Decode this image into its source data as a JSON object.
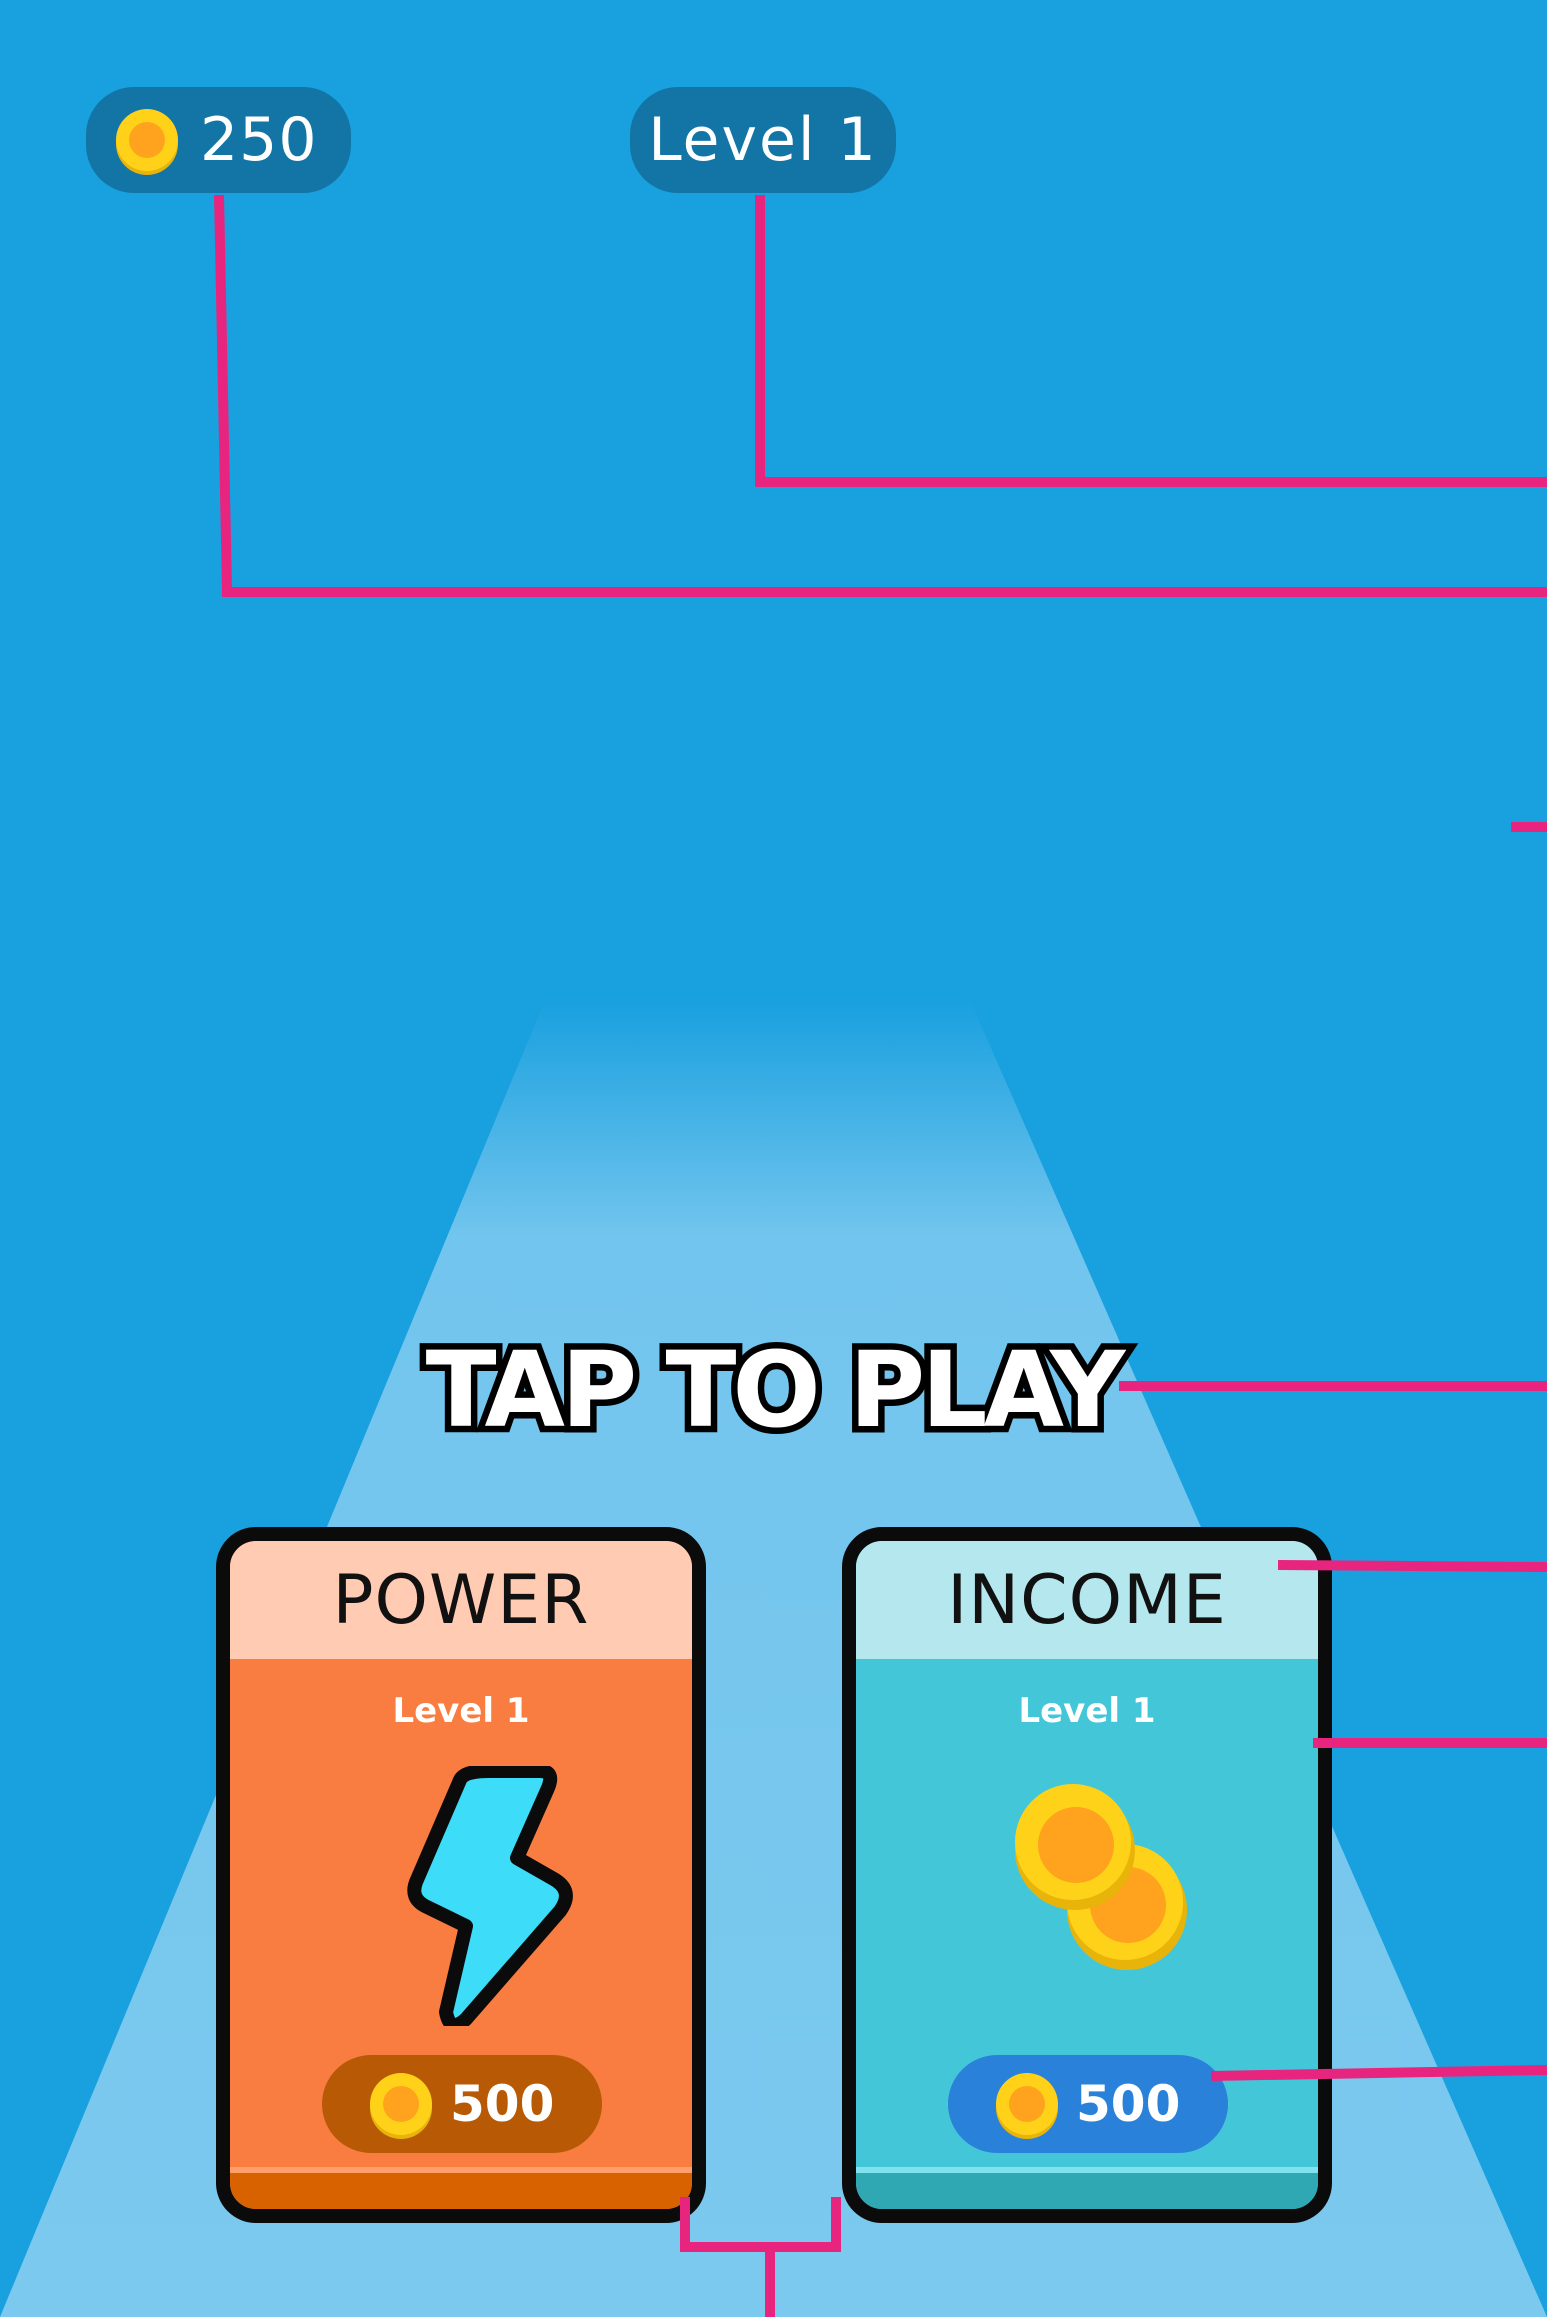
{
  "hud": {
    "coins": "250",
    "level": "Level 1"
  },
  "cta": {
    "label": "TAP TO PLAY"
  },
  "cards": {
    "power": {
      "title": "POWER",
      "level": "Level 1",
      "price": "500",
      "icon": "lightning-bolt-icon"
    },
    "income": {
      "title": "INCOME",
      "level": "Level 1",
      "price": "500",
      "icon": "coins-icon"
    }
  },
  "colors": {
    "background": "#19a0df",
    "hud_pill": "#1275a6",
    "power_card": "#f97d41",
    "income_card": "#43c7d8",
    "annotation_lines": "#e8257e",
    "coin": "#ffd219"
  }
}
